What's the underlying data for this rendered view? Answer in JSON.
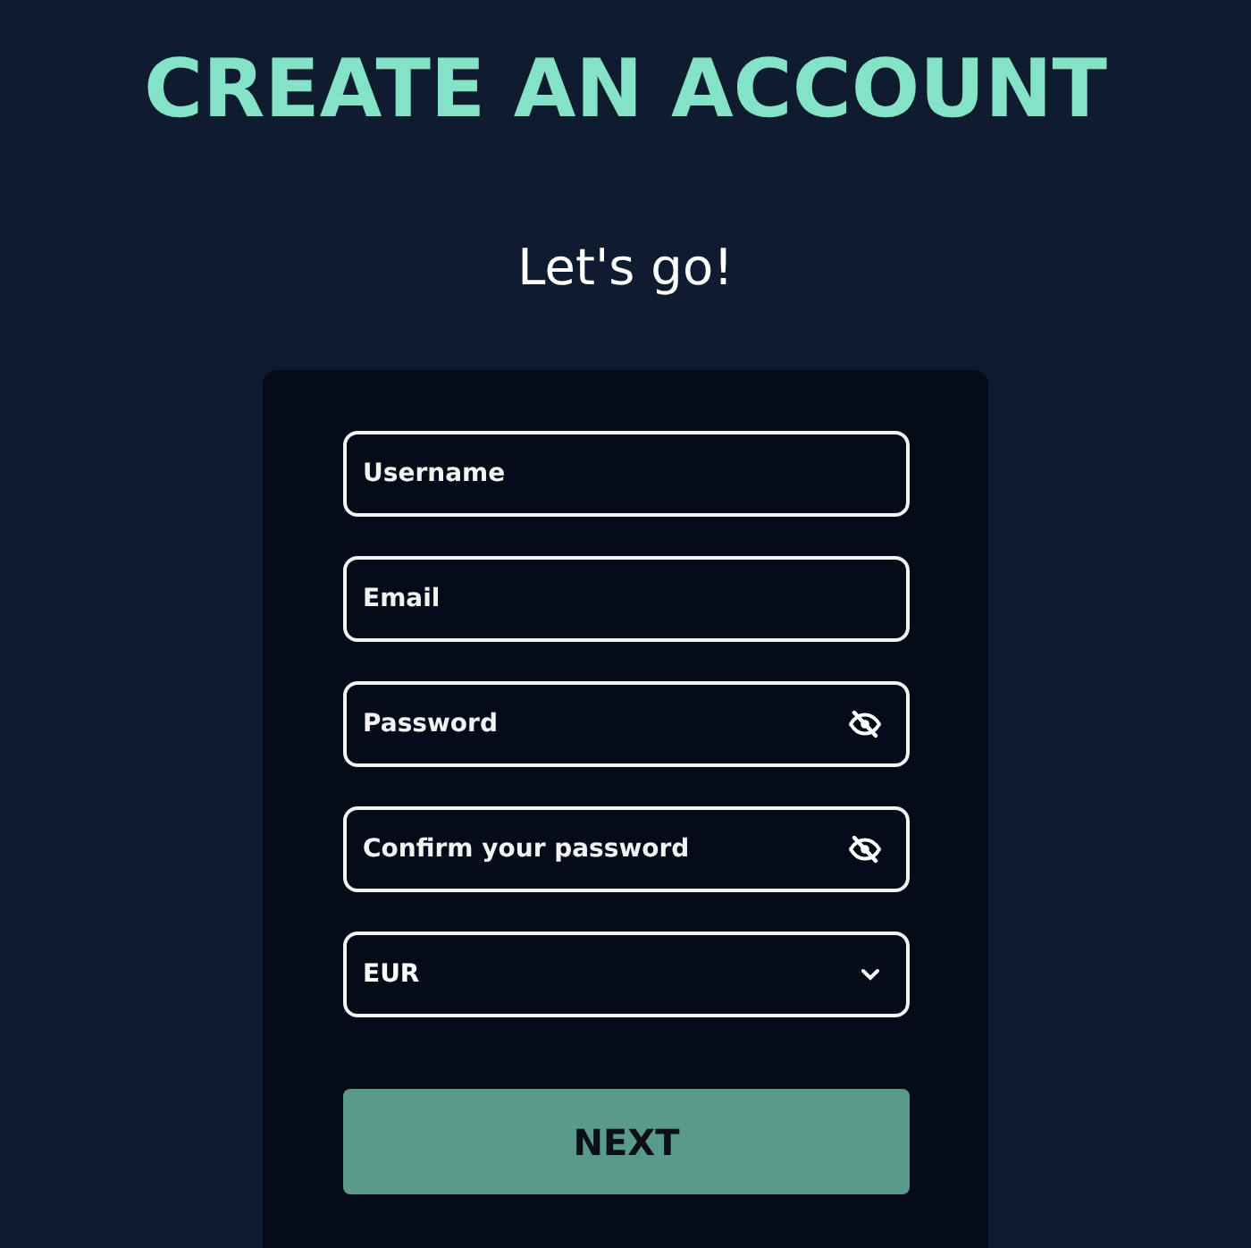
{
  "title": "CREATE AN ACCOUNT",
  "subtitle": "Let's go!",
  "fields": [
    {
      "kind": "text",
      "placeholder": "Username"
    },
    {
      "kind": "text",
      "placeholder": "Email"
    },
    {
      "kind": "password",
      "placeholder": "Password",
      "reveal": true
    },
    {
      "kind": "password",
      "placeholder": "Confirm your password",
      "reveal": true
    },
    {
      "kind": "select",
      "value": "EUR"
    }
  ],
  "submit": "NEXT"
}
